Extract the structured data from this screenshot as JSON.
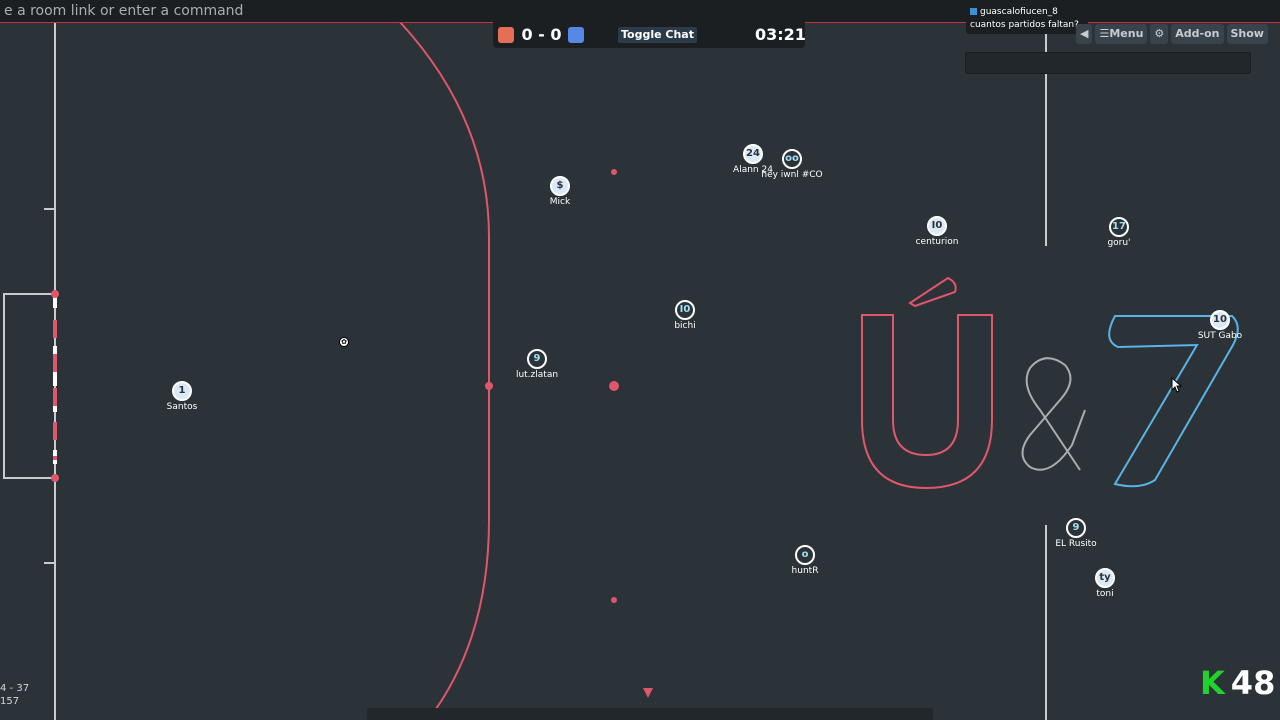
{
  "command_bar": {
    "placeholder": "e a room link or enter a command"
  },
  "scoreboard": {
    "score": "0 - 0",
    "toggle_chat_label": "Toggle Chat",
    "timer": "03:21",
    "red_color": "#e56e56",
    "blue_color": "#5689e5"
  },
  "chat": {
    "messages": [
      {
        "author": "guascalofiucen_8",
        "text": "cuantos partidos faltan?"
      }
    ]
  },
  "right_buttons": {
    "speaker_icon": "speaker-icon",
    "menu_label": "☰Menu",
    "settings_icon": "gear-icon",
    "addon_label": "Add-on",
    "show_label": "Show"
  },
  "players": [
    {
      "number": "1",
      "name": "Santos",
      "team": "blue"
    },
    {
      "number": "$",
      "name": "Mick",
      "team": "blue"
    },
    {
      "number": "24",
      "name": "Alann 24",
      "team": "blue"
    },
    {
      "number": "oo",
      "name": "hey iwnl #CO",
      "team": "dark"
    },
    {
      "number": "I0",
      "name": "centurion",
      "team": "blue"
    },
    {
      "number": "17",
      "name": "goru'",
      "team": "dark"
    },
    {
      "number": "I0",
      "name": "bichi",
      "team": "dark"
    },
    {
      "number": "9",
      "name": "lut.zlatan",
      "team": "dark"
    },
    {
      "number": "10",
      "name": "SUT Gabo",
      "team": "blue"
    },
    {
      "number": "9",
      "name": "EL Rusito",
      "team": "dark"
    },
    {
      "number": "o",
      "name": "huntR",
      "team": "dark"
    },
    {
      "number": "ty",
      "name": "toni",
      "team": "blue"
    }
  ],
  "field_logo": {
    "text": "Ú&7",
    "u_color": "#e0566a",
    "amp_color": "#a8adb1",
    "seven_color": "#5ab3e6"
  },
  "stats": {
    "line1": "4 - 37",
    "line2": "157"
  },
  "badge": {
    "k": "K",
    "number": "48"
  }
}
